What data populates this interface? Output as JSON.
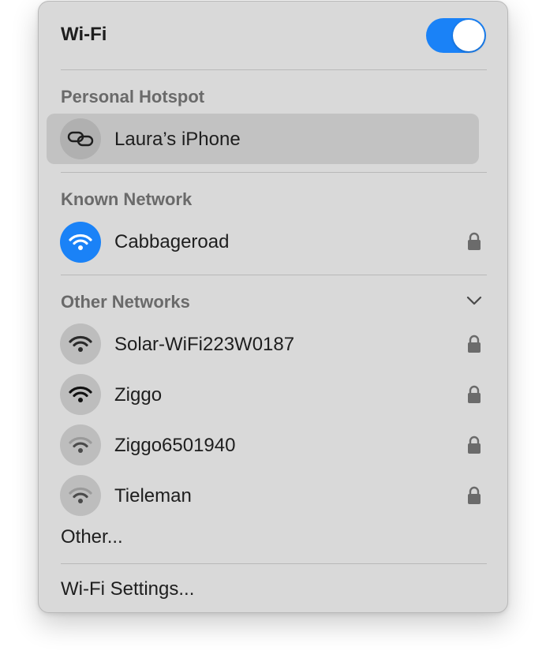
{
  "header": {
    "title": "Wi-Fi",
    "toggle_state": "on",
    "accent_color": "#1a82f7"
  },
  "personal_hotspot": {
    "heading": "Personal Hotspot",
    "item": {
      "name": "Laura’s iPhone",
      "icon": "link-icon"
    }
  },
  "known_network": {
    "heading": "Known Network",
    "item": {
      "name": "Cabbageroad",
      "icon": "wifi-icon",
      "locked": true,
      "connected": true
    }
  },
  "other_networks": {
    "heading": "Other Networks",
    "expanded": true,
    "items": [
      {
        "name": "Solar-WiFi223W0187",
        "icon": "wifi-icon",
        "locked": true,
        "signal": 3
      },
      {
        "name": "Ziggo",
        "icon": "wifi-icon",
        "locked": true,
        "signal": 3
      },
      {
        "name": "Ziggo6501940",
        "icon": "wifi-icon",
        "locked": true,
        "signal": 1
      },
      {
        "name": "Tieleman",
        "icon": "wifi-icon",
        "locked": true,
        "signal": 1
      }
    ],
    "other_label": "Other..."
  },
  "footer": {
    "settings_label": "Wi-Fi Settings..."
  }
}
